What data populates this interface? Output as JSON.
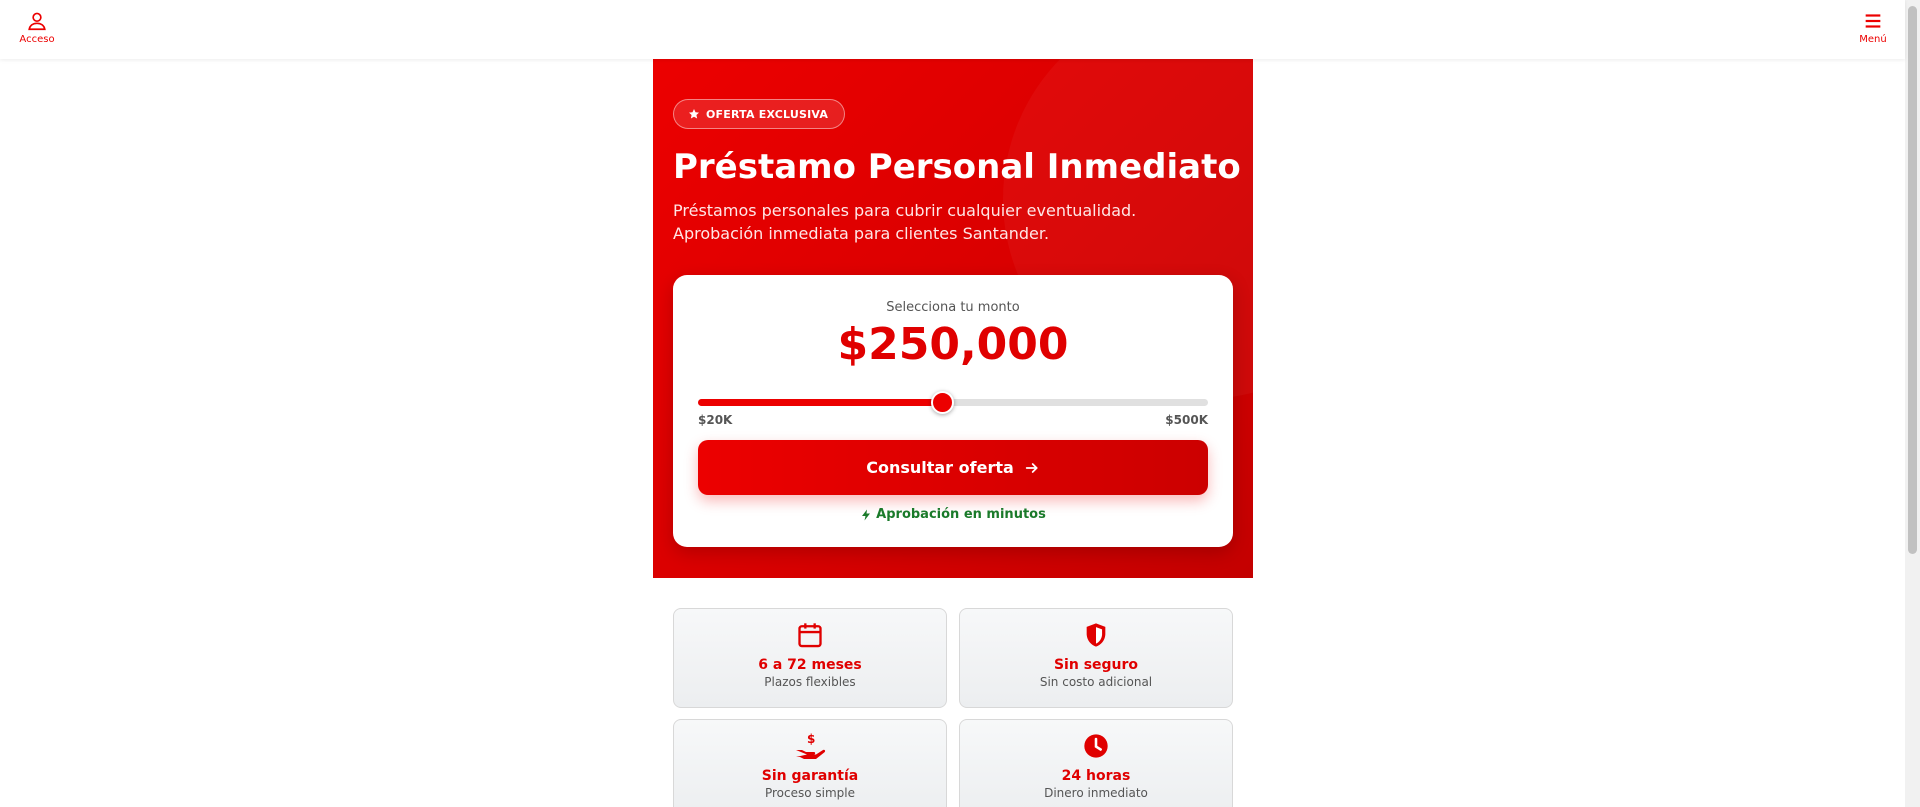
{
  "header": {
    "login_label": "Acceso",
    "menu_label": "Menú"
  },
  "hero": {
    "badge": "OFERTA EXCLUSIVA",
    "title": "Préstamo Personal Inmediato",
    "lead": "Préstamos personales para cubrir cualquier eventualidad. Aprobación inmediata para clientes Santander."
  },
  "calculator": {
    "label": "Selecciona tu monto",
    "amount": "$250,000",
    "slider_min_label": "$20K",
    "slider_max_label": "$500K",
    "slider_fraction": 0.479,
    "cta_label": "Consultar oferta",
    "approval_text": "Aprobación en minutos"
  },
  "features": [
    {
      "icon": "calendar-icon",
      "title": "6 a 72 meses",
      "subtitle": "Plazos flexibles"
    },
    {
      "icon": "shield-icon",
      "title": "Sin seguro",
      "subtitle": "Sin costo adicional"
    },
    {
      "icon": "hand-dollar-icon",
      "title": "Sin garantía",
      "subtitle": "Proceso simple"
    },
    {
      "icon": "clock-icon",
      "title": "24 horas",
      "subtitle": "Dinero inmediato"
    }
  ],
  "colors": {
    "brand": "#ec0000",
    "approval": "#1a7a2a"
  }
}
